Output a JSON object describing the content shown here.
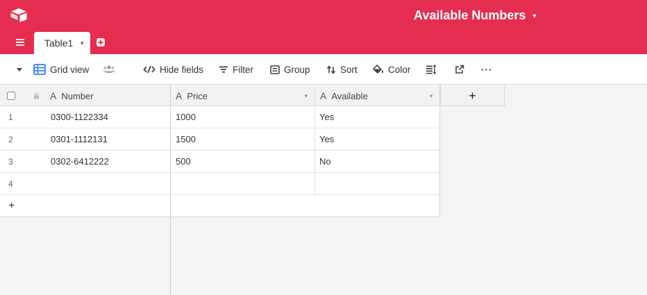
{
  "header": {
    "base_title": "Available Numbers",
    "accent_color": "#e52e4f"
  },
  "tabs": [
    {
      "label": "Table1"
    }
  ],
  "toolbar": {
    "view_name": "Grid view",
    "hide_fields": "Hide fields",
    "filter": "Filter",
    "group": "Group",
    "sort": "Sort",
    "color": "Color",
    "more": "···"
  },
  "grid": {
    "columns": [
      {
        "name": "Number",
        "type_icon": "text-field-icon"
      },
      {
        "name": "Price",
        "type_icon": "text-field-icon"
      },
      {
        "name": "Available",
        "type_icon": "text-field-icon"
      }
    ],
    "add_column": "+",
    "add_row": "+",
    "rows": [
      {
        "num": "1",
        "number": "0300-1122334",
        "price": "1000",
        "available": "Yes"
      },
      {
        "num": "2",
        "number": "0301-1112131",
        "price": "1500",
        "available": "Yes"
      },
      {
        "num": "3",
        "number": "0302-6412222",
        "price": "500",
        "available": "No"
      },
      {
        "num": "4",
        "number": "",
        "price": "",
        "available": ""
      }
    ]
  }
}
